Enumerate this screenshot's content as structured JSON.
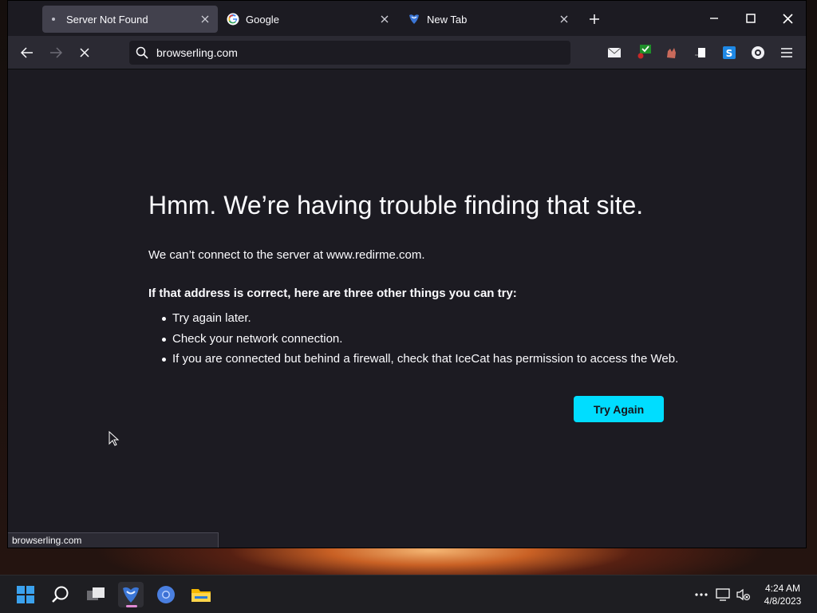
{
  "browser": {
    "tabs": [
      {
        "label": "Server Not Found",
        "favicon": "dot-icon",
        "active": true
      },
      {
        "label": "Google",
        "favicon": "google-icon",
        "active": false
      },
      {
        "label": "New Tab",
        "favicon": "icecat-icon",
        "active": false
      }
    ],
    "url": "browserling.com",
    "status_text": "browserling.com"
  },
  "error_page": {
    "title": "Hmm. We’re having trouble finding that site.",
    "description": "We can’t connect to the server at www.redirme.com.",
    "suggestions_heading": "If that address is correct, here are three other things you can try:",
    "suggestions": [
      "Try again later.",
      "Check your network connection.",
      "If you are connected but behind a firewall, check that IceCat has permission to access the Web."
    ],
    "button_label": "Try Again"
  },
  "taskbar": {
    "time": "4:24 AM",
    "date": "4/8/2023"
  },
  "colors": {
    "accent_button": "#00ddff",
    "page_background": "#1c1b22",
    "toolbar": "#2b2a33"
  }
}
